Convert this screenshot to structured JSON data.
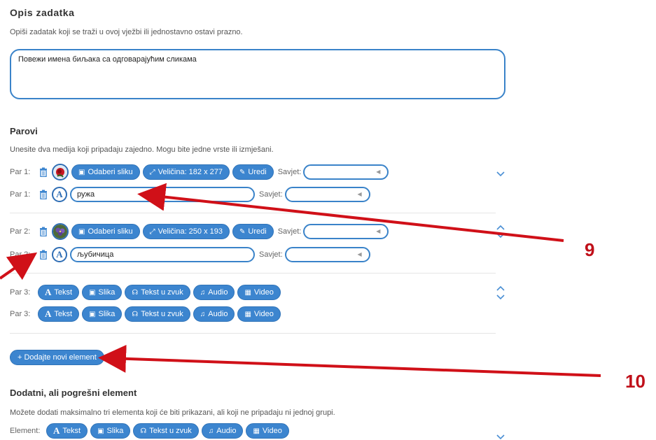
{
  "opis": {
    "title": "Opis zadatka",
    "desc": "Opiši zadatak koji se traži u ovoj vježbi ili jednostavno ostavi prazno.",
    "value": "Повежи имена биљака са одговарајућим сликама"
  },
  "parovi": {
    "title": "Parovi",
    "desc": "Unesite dva medija koji pripadaju zajedno. Mogu bite jedne vrste ili izmješani."
  },
  "pair1_img": {
    "label": "Par 1:",
    "choose": "Odaberi sliku",
    "size": "Veličina: 182 x 277",
    "edit": "Uredi",
    "savjet": "Savjet:"
  },
  "pair1_txt": {
    "label": "Par 1:",
    "value": "ружа",
    "savjet": "Savjet:"
  },
  "pair2_img": {
    "label": "Par 2:",
    "choose": "Odaberi sliku",
    "size": "Veličina: 250 x 193",
    "edit": "Uredi",
    "savjet": "Savjet:"
  },
  "pair2_txt": {
    "label": "Par 2:",
    "value": "љубичица",
    "savjet": "Savjet:"
  },
  "pair3_a": {
    "label": "Par 3:",
    "tekst": "Tekst",
    "slika": "Slika",
    "tts": "Tekst u zvuk",
    "audio": "Audio",
    "video": "Video"
  },
  "pair3_b": {
    "label": "Par 3:",
    "tekst": "Tekst",
    "slika": "Slika",
    "tts": "Tekst u zvuk",
    "audio": "Audio",
    "video": "Video"
  },
  "add_button": "+ Dodajte novi element",
  "extra": {
    "title": "Dodatni, ali pogrešni element",
    "desc": "Možete dodati maksimalno tri elementa koji će biti prikazani, ali koji ne pripadaju ni jednoj grupi.",
    "label": "Element:",
    "tekst": "Tekst",
    "slika": "Slika",
    "tts": "Tekst u zvuk",
    "audio": "Audio",
    "video": "Video"
  },
  "callouts": {
    "nine": "9",
    "ten": "10"
  },
  "colors": {
    "accent": "#3c85cf",
    "border": "#3a83c9",
    "callout": "#c0101a"
  }
}
